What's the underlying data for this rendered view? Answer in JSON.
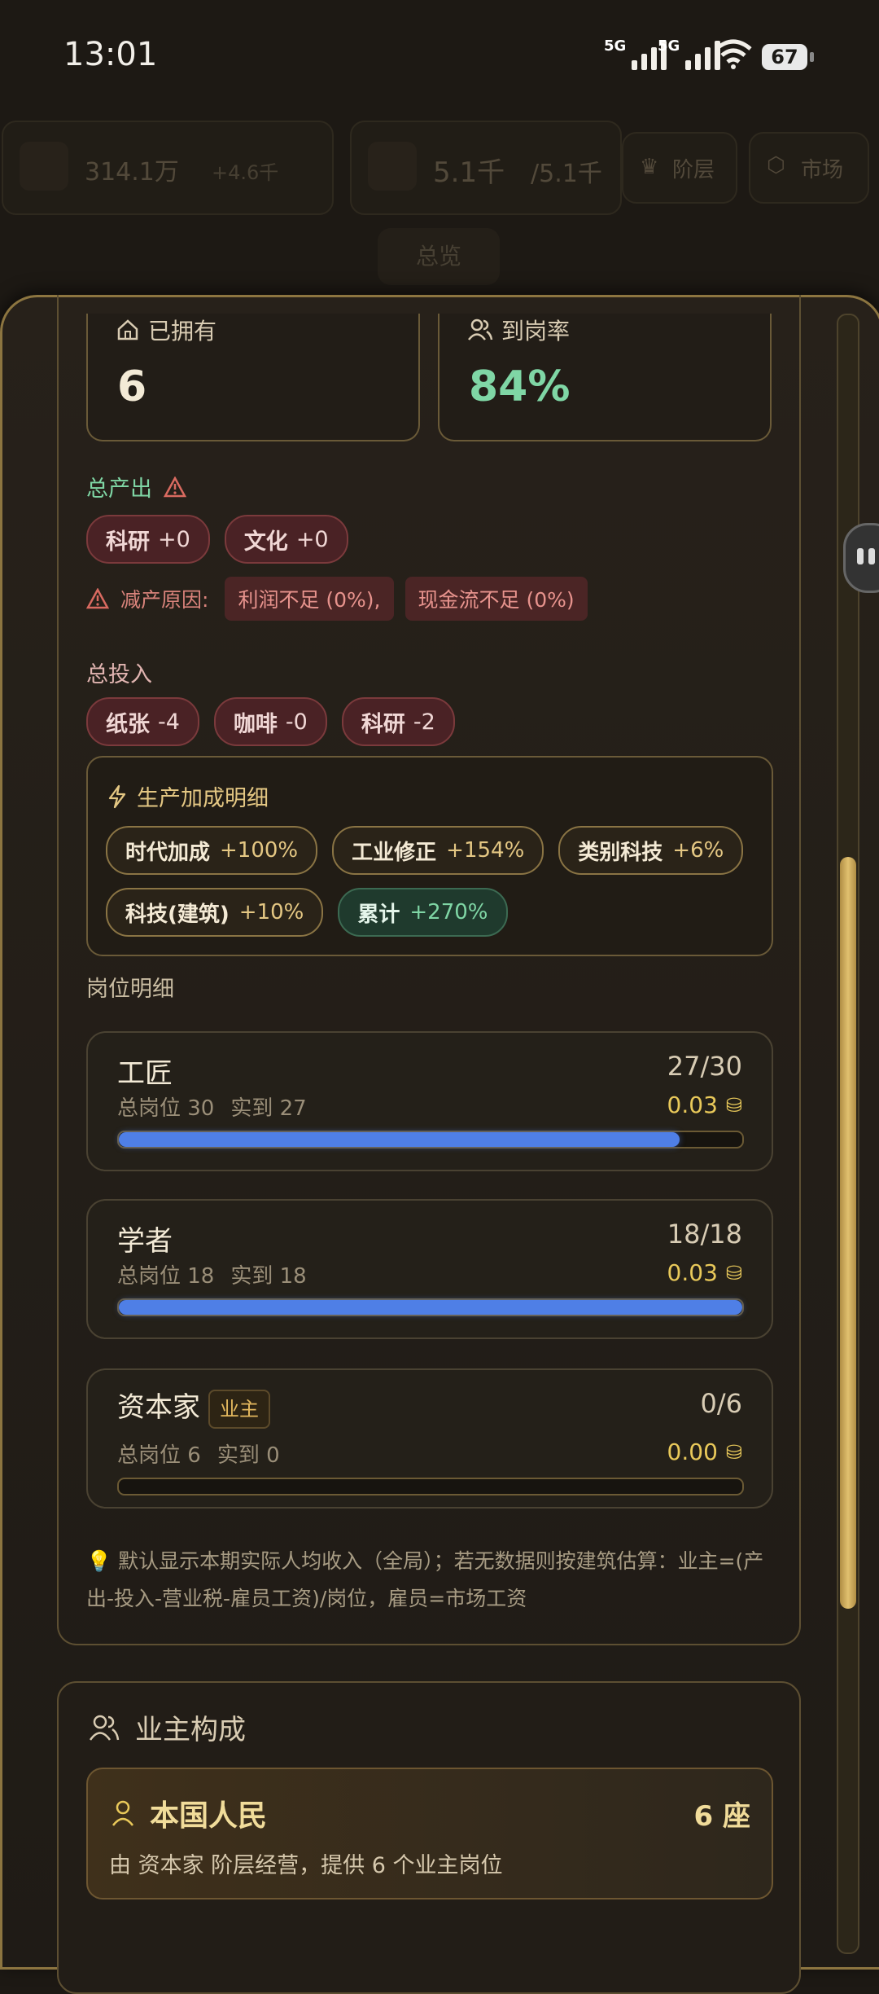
{
  "status_bar": {
    "time": "13:01",
    "net1": "5G",
    "net2": "5G",
    "battery": "67"
  },
  "top_bar": {
    "money": "314.1万",
    "money_delta": "+4.6千",
    "population": "5.1千",
    "population_cap": "/5.1千",
    "tab_class": "阶层",
    "tab_market": "市场",
    "active_tab": "总览"
  },
  "stats": {
    "owned_label": "已拥有",
    "owned_value": "6",
    "attendance_label": "到岗率",
    "attendance_value": "84%"
  },
  "output": {
    "title": "总产出",
    "items": [
      {
        "name": "科研",
        "value": "+0"
      },
      {
        "name": "文化",
        "value": "+0"
      }
    ],
    "reduction_label": "减产原因:",
    "reasons": [
      "利润不足 (0%),",
      "现金流不足 (0%)"
    ]
  },
  "input": {
    "title": "总投入",
    "items": [
      {
        "name": "纸张",
        "value": "-4"
      },
      {
        "name": "咖啡",
        "value": "-0"
      },
      {
        "name": "科研",
        "value": "-2"
      }
    ]
  },
  "bonus": {
    "title": "生产加成明细",
    "items": [
      {
        "name": "时代加成",
        "value": "+100%"
      },
      {
        "name": "工业修正",
        "value": "+154%"
      },
      {
        "name": "类别科技",
        "value": "+6%"
      },
      {
        "name": "科技(建筑)",
        "value": "+10%"
      }
    ],
    "total": {
      "name": "累计",
      "value": "+270%"
    }
  },
  "jobs": {
    "title": "岗位明细",
    "items": [
      {
        "name": "工匠",
        "fraction": "27/30",
        "total": "总岗位 30",
        "actual": "实到 27",
        "wage": "0.03",
        "fill": 0.9
      },
      {
        "name": "学者",
        "fraction": "18/18",
        "total": "总岗位 18",
        "actual": "实到 18",
        "wage": "0.03",
        "fill": 1.0
      },
      {
        "name": "资本家",
        "tag": "业主",
        "fraction": "0/6",
        "total": "总岗位 6",
        "actual": "实到 0",
        "wage": "0.00",
        "fill": 0.0
      }
    ],
    "note": "默认显示本期实际人均收入（全局）；若无数据则按建筑估算：业主=(产出-投入-营业税-雇员工资)/岗位，雇员=市场工资"
  },
  "owners": {
    "title": "业主构成",
    "card": {
      "name": "本国人民",
      "count": "6 座",
      "desc": "由 资本家 阶层经营，提供 6 个业主岗位"
    }
  },
  "colors": {
    "accent_gold": "#e9c95a",
    "progress_blue": "#4f7fe6",
    "green": "#7fd6a5"
  }
}
